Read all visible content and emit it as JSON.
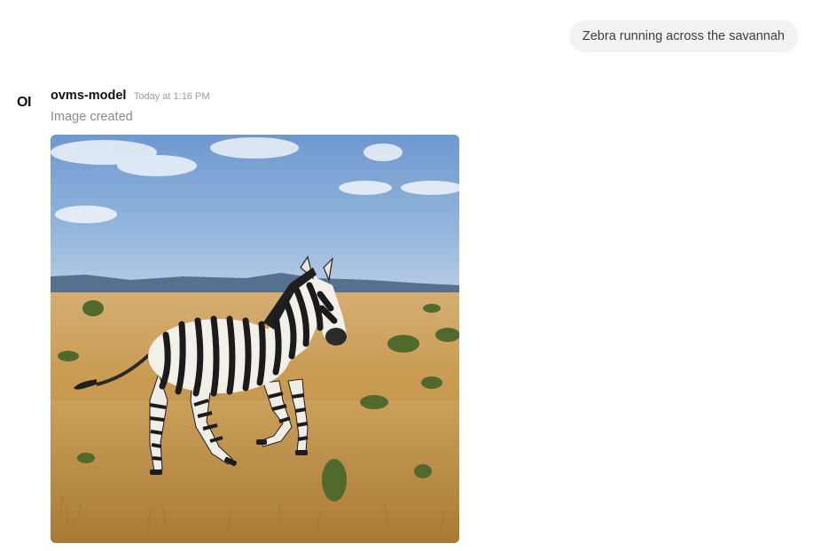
{
  "user_message": {
    "text": "Zebra running across the savannah"
  },
  "assistant": {
    "avatar_text": "OI",
    "model_name": "ovms-model",
    "timestamp": "Today at 1:16 PM",
    "status": "Image created"
  },
  "generated_image": {
    "subject": "zebra-on-savannah"
  },
  "colors": {
    "user_bubble_bg": "#f2f2f3",
    "muted_text": "#8a8a90",
    "sky": "#7fa6d6",
    "grass": "#cda15a"
  }
}
